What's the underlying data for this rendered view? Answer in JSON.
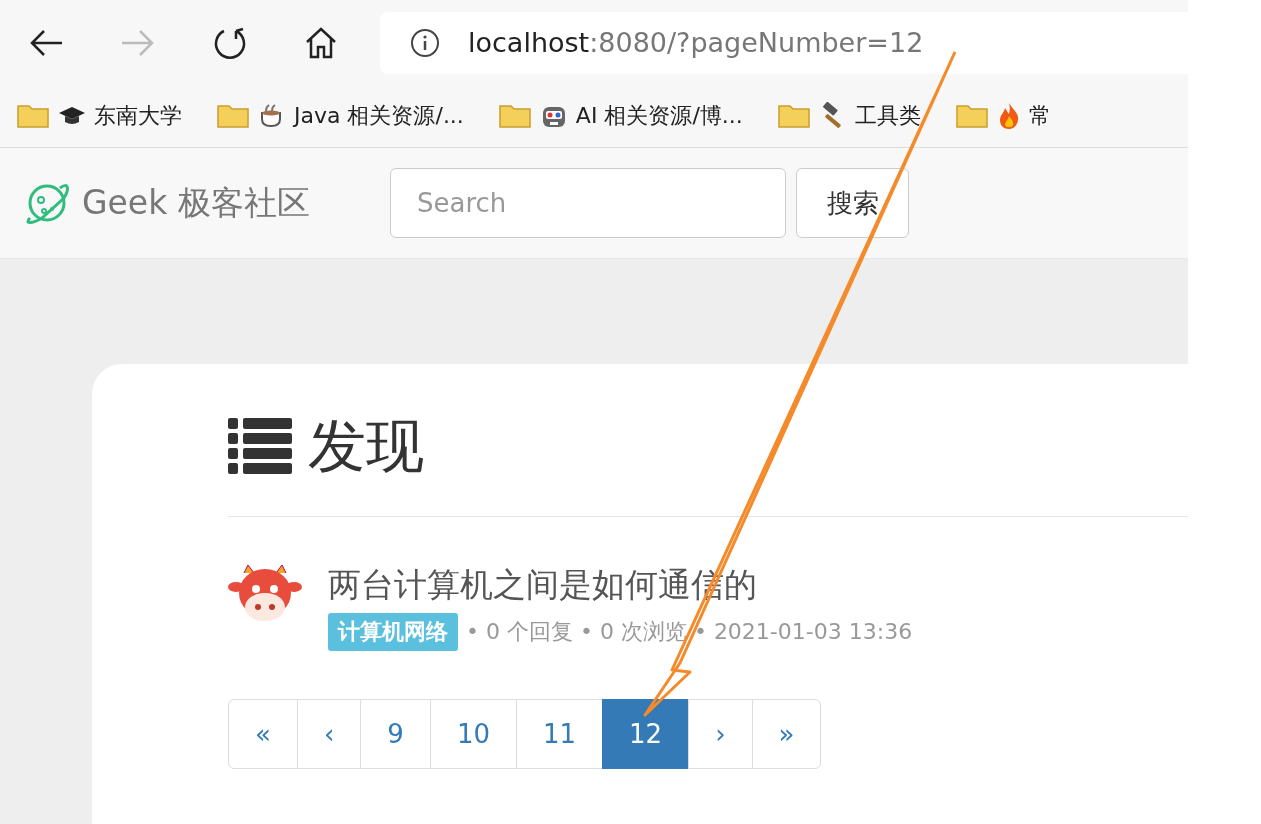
{
  "browser": {
    "url_host": "localhost",
    "url_rest": ":8080/?pageNumber=12"
  },
  "bookmarks": [
    {
      "label": "东南大学"
    },
    {
      "label": "Java 相关资源/..."
    },
    {
      "label": "AI 相关资源/博..."
    },
    {
      "label": "工具类"
    },
    {
      "label": "常"
    }
  ],
  "navbar": {
    "brand": "Geek 极客社区",
    "search": {
      "placeholder": "Search"
    },
    "search_button": "搜索"
  },
  "page": {
    "heading": "发现",
    "posts": [
      {
        "title": "两台计算机之间是如何通信的",
        "tag": "计算机网络",
        "meta": "• 0 个回复 • 0 次浏览 • 2021-01-03 13:36"
      }
    ],
    "pagination": [
      {
        "label": "«",
        "selected": false
      },
      {
        "label": "‹",
        "selected": false
      },
      {
        "label": "9",
        "selected": false
      },
      {
        "label": "10",
        "selected": false
      },
      {
        "label": "11",
        "selected": false
      },
      {
        "label": "12",
        "selected": true
      },
      {
        "label": "›",
        "selected": false
      },
      {
        "label": "»",
        "selected": false
      }
    ]
  }
}
